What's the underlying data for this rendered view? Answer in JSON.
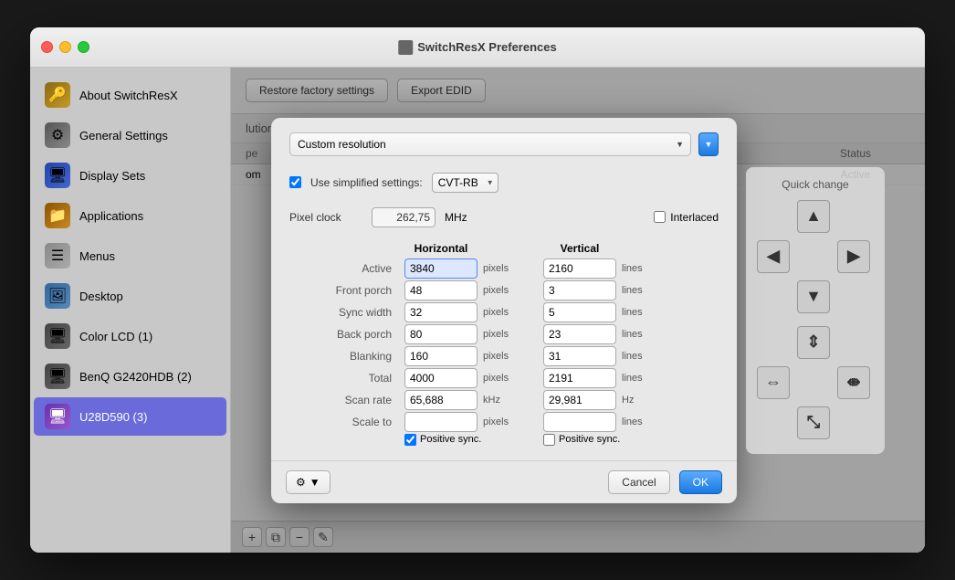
{
  "window": {
    "title": "SwitchResX Preferences"
  },
  "sidebar": {
    "items": [
      {
        "id": "about",
        "label": "About SwitchResX",
        "icon": "about"
      },
      {
        "id": "general",
        "label": "General Settings",
        "icon": "general"
      },
      {
        "id": "displaysets",
        "label": "Display Sets",
        "icon": "displaysets"
      },
      {
        "id": "applications",
        "label": "Applications",
        "icon": "applications"
      },
      {
        "id": "menus",
        "label": "Menus",
        "icon": "menus"
      },
      {
        "id": "desktop",
        "label": "Desktop",
        "icon": "desktop"
      },
      {
        "id": "colorlcd",
        "label": "Color LCD (1)",
        "icon": "colorlcd"
      },
      {
        "id": "benq",
        "label": "BenQ G2420HDB (2)",
        "icon": "benq"
      },
      {
        "id": "u28",
        "label": "U28D590 (3)",
        "icon": "u28",
        "active": true
      }
    ]
  },
  "toolbar": {
    "restore_label": "Restore factory settings",
    "export_label": "Export EDID"
  },
  "table": {
    "section_title": "lutions",
    "headers": [
      "pe",
      "Status"
    ],
    "rows": [
      {
        "type": "om",
        "status": "Active"
      }
    ]
  },
  "modal": {
    "resolution_options": [
      "Custom resolution"
    ],
    "resolution_selected": "Custom resolution",
    "simplified_label": "Use simplified settings:",
    "cvt_options": [
      "CVT-RB"
    ],
    "cvt_selected": "CVT-RB",
    "pixel_clock_label": "Pixel clock",
    "pixel_clock_value": "262,75",
    "mhz_label": "MHz",
    "interlaced_label": "Interlaced",
    "columns": {
      "horizontal_label": "Horizontal",
      "vertical_label": "Vertical"
    },
    "rows": [
      {
        "label": "Active",
        "h_value": "3840",
        "h_unit": "pixels",
        "v_value": "2160",
        "v_unit": "lines",
        "h_active": true
      },
      {
        "label": "Front porch",
        "h_value": "48",
        "h_unit": "pixels",
        "v_value": "3",
        "v_unit": "lines"
      },
      {
        "label": "Sync width",
        "h_value": "32",
        "h_unit": "pixels",
        "v_value": "5",
        "v_unit": "lines"
      },
      {
        "label": "Back porch",
        "h_value": "80",
        "h_unit": "pixels",
        "v_value": "23",
        "v_unit": "lines"
      },
      {
        "label": "Blanking",
        "h_value": "160",
        "h_unit": "pixels",
        "v_value": "31",
        "v_unit": "lines"
      },
      {
        "label": "Total",
        "h_value": "4000",
        "h_unit": "pixels",
        "v_value": "2191",
        "v_unit": "lines"
      },
      {
        "label": "Scan rate",
        "h_value": "65,688",
        "h_unit": "kHz",
        "v_value": "29,981",
        "v_unit": "Hz"
      },
      {
        "label": "Scale to",
        "h_value": "",
        "h_unit": "pixels",
        "v_value": "",
        "v_unit": "lines"
      }
    ],
    "positive_sync_h": true,
    "positive_sync_h_label": "Positive sync.",
    "positive_sync_v": false,
    "positive_sync_v_label": "Positive sync.",
    "quick_change_title": "Quick change",
    "buttons": {
      "cancel": "Cancel",
      "ok": "OK"
    },
    "gear_label": "⚙"
  },
  "footer": {
    "add_icon": "+",
    "duplicate_icon": "⧉",
    "remove_icon": "−",
    "edit_icon": "✎"
  }
}
